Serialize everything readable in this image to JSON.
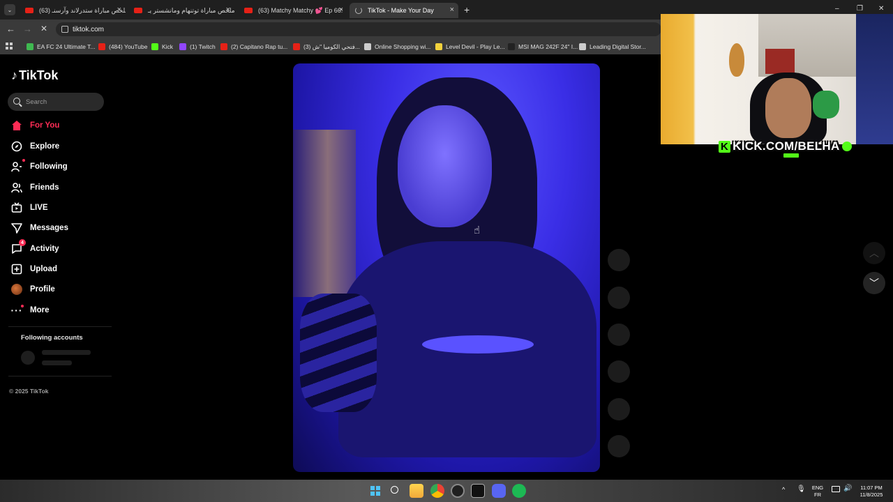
{
  "browser": {
    "tabs": [
      {
        "title": "(63) ملخص مباراة ستدرلاند وآرسنـ",
        "close": "×"
      },
      {
        "title": "ملخص مباراة توتنهام ومانشستر يـ",
        "close": "×"
      },
      {
        "title": "(63) Matchy Matchy 💕 Ep 66:",
        "close": "×"
      },
      {
        "title": "TikTok - Make Your Day",
        "close": "×"
      }
    ],
    "new_tab": "+",
    "window_controls": [
      "–",
      "❐",
      "✕"
    ],
    "url": "tiktok.com",
    "bookmarks": [
      {
        "label": "EA FC 24 Ultimate T...",
        "color": "#3fb950"
      },
      {
        "label": "(484) YouTube",
        "color": "#e62117"
      },
      {
        "label": "Kick",
        "color": "#53fc18"
      },
      {
        "label": "(1) Twitch",
        "color": "#9146ff"
      },
      {
        "label": "(2) Capitano Rap tu...",
        "color": "#e62117"
      },
      {
        "label": "(3) فتحي الكوميا \"ش...",
        "color": "#e62117"
      },
      {
        "label": "Online Shopping wi...",
        "color": "#cccccc"
      },
      {
        "label": "Level Devil - Play Le...",
        "color": "#f2d23c"
      },
      {
        "label": "MSI MAG 242F 24\" I...",
        "color": "#222222"
      },
      {
        "label": "Leading Digital Stor...",
        "color": "#cccccc"
      }
    ]
  },
  "tiktok": {
    "logo": "TikTok",
    "search_placeholder": "Search",
    "nav": [
      {
        "label": "For You",
        "icon": "home-icon"
      },
      {
        "label": "Explore",
        "icon": "compass-icon"
      },
      {
        "label": "Following",
        "icon": "following-icon"
      },
      {
        "label": "Friends",
        "icon": "friends-icon"
      },
      {
        "label": "LIVE",
        "icon": "live-icon"
      },
      {
        "label": "Messages",
        "icon": "messages-icon"
      },
      {
        "label": "Activity",
        "icon": "activity-icon",
        "badge": "4"
      },
      {
        "label": "Upload",
        "icon": "upload-icon"
      },
      {
        "label": "Profile",
        "icon": "profile-icon"
      },
      {
        "label": "More",
        "icon": "more-icon"
      }
    ],
    "following_accounts_heading": "Following accounts",
    "copyright": "© 2025 TikTok"
  },
  "stream_overlay": {
    "kick_handle": "KICK.COM/BELHA"
  },
  "taskbar": {
    "language": "ENG",
    "layout": "FR",
    "time": "11:07 PM",
    "date": "11/8/2025"
  },
  "colors": {
    "tiktok_accent": "#fe2c55",
    "kick_green": "#53fc18",
    "video_blue": "#3a2ee6"
  }
}
